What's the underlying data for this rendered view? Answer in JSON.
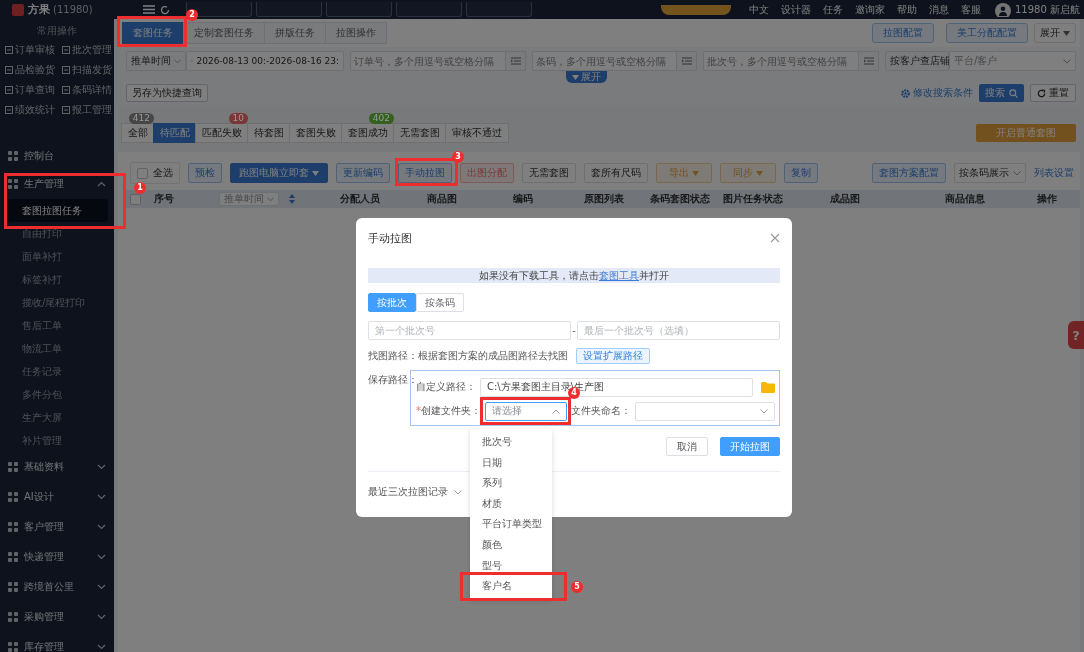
{
  "header": {
    "logo": "方果",
    "account_no": "(11980)",
    "links": [
      "中文",
      "设计器",
      "任务",
      "邀询家",
      "帮助",
      "消息",
      "客服"
    ],
    "user": "11980 新启航"
  },
  "sidebar": {
    "section_title": "常用操作",
    "quick_actions": [
      "订单审核",
      "批次管理",
      "品检验货",
      "扫描发货",
      "订单查询",
      "条码详情",
      "绩效统计",
      "报工管理"
    ],
    "menu": [
      {
        "kind": "link",
        "label": "控制台"
      },
      {
        "kind": "group",
        "label": "生产管理",
        "expanded": true,
        "children": [
          {
            "label": "套图拉图任务",
            "selected": true
          },
          {
            "label": "自由打印",
            "selected": false
          },
          {
            "label": "面单补打",
            "selected": false
          },
          {
            "label": "标签补打",
            "selected": false
          },
          {
            "label": "揽收/尾程打印",
            "selected": false
          },
          {
            "label": "售后工单",
            "selected": false
          },
          {
            "label": "物流工单",
            "selected": false
          },
          {
            "label": "任务记录",
            "selected": false
          },
          {
            "label": "多件分包",
            "selected": false
          },
          {
            "label": "生产大屏",
            "selected": false
          },
          {
            "label": "补片管理",
            "selected": false
          }
        ]
      },
      {
        "kind": "group",
        "label": "基础资料",
        "expanded": false
      },
      {
        "kind": "group",
        "label": "AI设计",
        "expanded": false
      },
      {
        "kind": "group",
        "label": "客户管理",
        "expanded": false
      },
      {
        "kind": "group",
        "label": "快递管理",
        "expanded": false
      },
      {
        "kind": "group",
        "label": "跨境首公里",
        "expanded": false
      },
      {
        "kind": "group",
        "label": "采购管理",
        "expanded": false
      },
      {
        "kind": "group",
        "label": "库存管理",
        "expanded": false
      }
    ]
  },
  "page_tabs": [
    {
      "label": "套图任务",
      "selected": true
    },
    {
      "label": "定制套图任务",
      "selected": false
    },
    {
      "label": "拼版任务",
      "selected": false
    },
    {
      "label": "拉图操作",
      "selected": false
    }
  ],
  "top_buttons": [
    "拉图配置",
    "美工分配配置"
  ],
  "expand_menu": "展开",
  "filters": {
    "time_type": "推单时间",
    "date_range": "2026-08-13 00:-2026-08-16 23:",
    "order_placeholder": "订单号，多个用逗号或空格分隔",
    "barcode_placeholder": "条码，多个用逗号或空格分隔",
    "batch_placeholder": "批次号，多个用逗号或空格分隔",
    "shop_mode": "按客户查店铺",
    "platform_placeholder": "平台/客户",
    "expand_toggle": "展开",
    "save_query": "另存为快捷查询",
    "edit_conditions": "修改搜索条件",
    "search": "搜索",
    "reset": "重置"
  },
  "status_tabs": [
    {
      "label": "全部",
      "selected": false,
      "count": "412",
      "color": "#464646"
    },
    {
      "label": "待匹配",
      "selected": true
    },
    {
      "label": "匹配失败",
      "selected": false,
      "count": "10",
      "color": "#7b3636"
    },
    {
      "label": "待套图",
      "selected": false
    },
    {
      "label": "套图失败",
      "selected": false
    },
    {
      "label": "套图成功",
      "selected": false,
      "count": "402",
      "color": "#34611d"
    },
    {
      "label": "无需套图",
      "selected": false
    },
    {
      "label": "审核不通过",
      "selected": false
    }
  ],
  "start_button": "开启普通套图",
  "toolbar": [
    {
      "kind": "checkbox",
      "label": "全选",
      "checked": false
    },
    {
      "kind": "outline",
      "label": "预检"
    },
    {
      "kind": "primary",
      "label": "跑图电脑立即套",
      "menu": true
    },
    {
      "kind": "outline",
      "label": "更新编码"
    },
    {
      "kind": "outline",
      "label": "手动拉图"
    },
    {
      "kind": "danger",
      "label": "出图分配"
    },
    {
      "kind": "plain",
      "label": "无需套图"
    },
    {
      "kind": "plain",
      "label": "套所有尺码"
    },
    {
      "kind": "warning",
      "label": "导出",
      "menu": true
    },
    {
      "kind": "warning",
      "label": "同步",
      "menu": true
    },
    {
      "kind": "outline",
      "label": "复制"
    }
  ],
  "toolbar_right": {
    "scheme_config": "套图方案配置",
    "display_mode": "按条码展示",
    "list_settings": "列表设置"
  },
  "table": {
    "select_all_checked": false,
    "sort_field": "推单时间",
    "columns": [
      "序号",
      "分配人员",
      "商品图",
      "编码",
      "原图列表",
      "条码套图状态",
      "图片任务状态",
      "成品图",
      "商品信息",
      "操作"
    ]
  },
  "help_button": "?",
  "dialog": {
    "title": "手动拉图",
    "info_before": "如果没有下载工具，请点击",
    "info_link": "套图工具",
    "info_after": "并打开",
    "modes": [
      {
        "label": "按批次",
        "selected": true
      },
      {
        "label": "按条码",
        "selected": false
      }
    ],
    "first_batch_placeholder": "第一个批次号",
    "separator": "-",
    "last_batch_placeholder": "最后一个批次号（选填）",
    "find_path_label": "找图路径：根据套图方案的成品图路径去找图",
    "ext_path_button": "设置扩展路径",
    "save_path_label": "保存路径：",
    "custom_path_label": "自定义路径：",
    "custom_path_value": "C:\\方果套图主目录\\生产图",
    "required_mark": "*",
    "create_folder_label": "创建文件夹：",
    "folder_select_placeholder": "请选择",
    "folder_select_open": true,
    "folder_naming_label": "文件夹命名：",
    "cancel": "取消",
    "start": "开始拉图",
    "history": "最近三次拉图记录"
  },
  "dropdown": {
    "options": [
      "批次号",
      "日期",
      "系列",
      "材质",
      "平台订单类型",
      "颜色",
      "型号",
      "客户名"
    ]
  },
  "annotations": [
    {
      "number": "1"
    },
    {
      "number": "2"
    },
    {
      "number": "3"
    },
    {
      "number": "4"
    },
    {
      "number": "5"
    }
  ]
}
